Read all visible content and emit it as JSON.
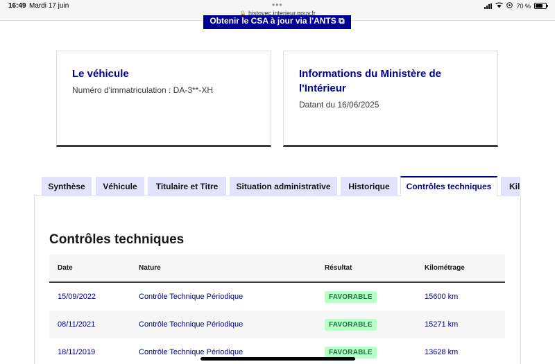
{
  "status_bar": {
    "time": "16:49",
    "date": "Mardi 17 juin",
    "url": "histovec.interieur.gouv.fr",
    "battery": "70 %",
    "battery_level": 0.7
  },
  "top_button": {
    "label": "Obtenir le CSA à jour via l'ANTS"
  },
  "vehicle_card": {
    "title": "Le véhicule",
    "registration": "Numéro d'immatriculation : DA-3**-XH"
  },
  "ministry_card": {
    "title": "Informations du Ministère de l'Intérieur",
    "date": "Datant du 16/06/2025"
  },
  "tabs": [
    {
      "label": "Synthèse"
    },
    {
      "label": "Véhicule"
    },
    {
      "label": "Titulaire et Titre"
    },
    {
      "label": "Situation administrative"
    },
    {
      "label": "Historique"
    },
    {
      "label": "Contrôles techniques",
      "active": true
    },
    {
      "label": "Kilo"
    }
  ],
  "section": {
    "title": "Contrôles techniques"
  },
  "table": {
    "headers": [
      "Date",
      "Nature",
      "Résultat",
      "Kilométrage"
    ],
    "rows": [
      {
        "date": "15/09/2022",
        "nature": "Contrôle Technique Périodique",
        "result": "FAVORABLE",
        "km": "15600 km"
      },
      {
        "date": "08/11/2021",
        "nature": "Contrôle Technique Périodique",
        "result": "FAVORABLE",
        "km": "15271 km"
      },
      {
        "date": "18/11/2019",
        "nature": "Contrôle Technique Périodique",
        "result": "FAVORABLE",
        "km": "13628 km"
      }
    ]
  },
  "colors": {
    "primary_blue": "#000091",
    "tab_background": "#e3e3fd",
    "badge_background": "#b8fec9",
    "badge_text": "#18753c"
  }
}
